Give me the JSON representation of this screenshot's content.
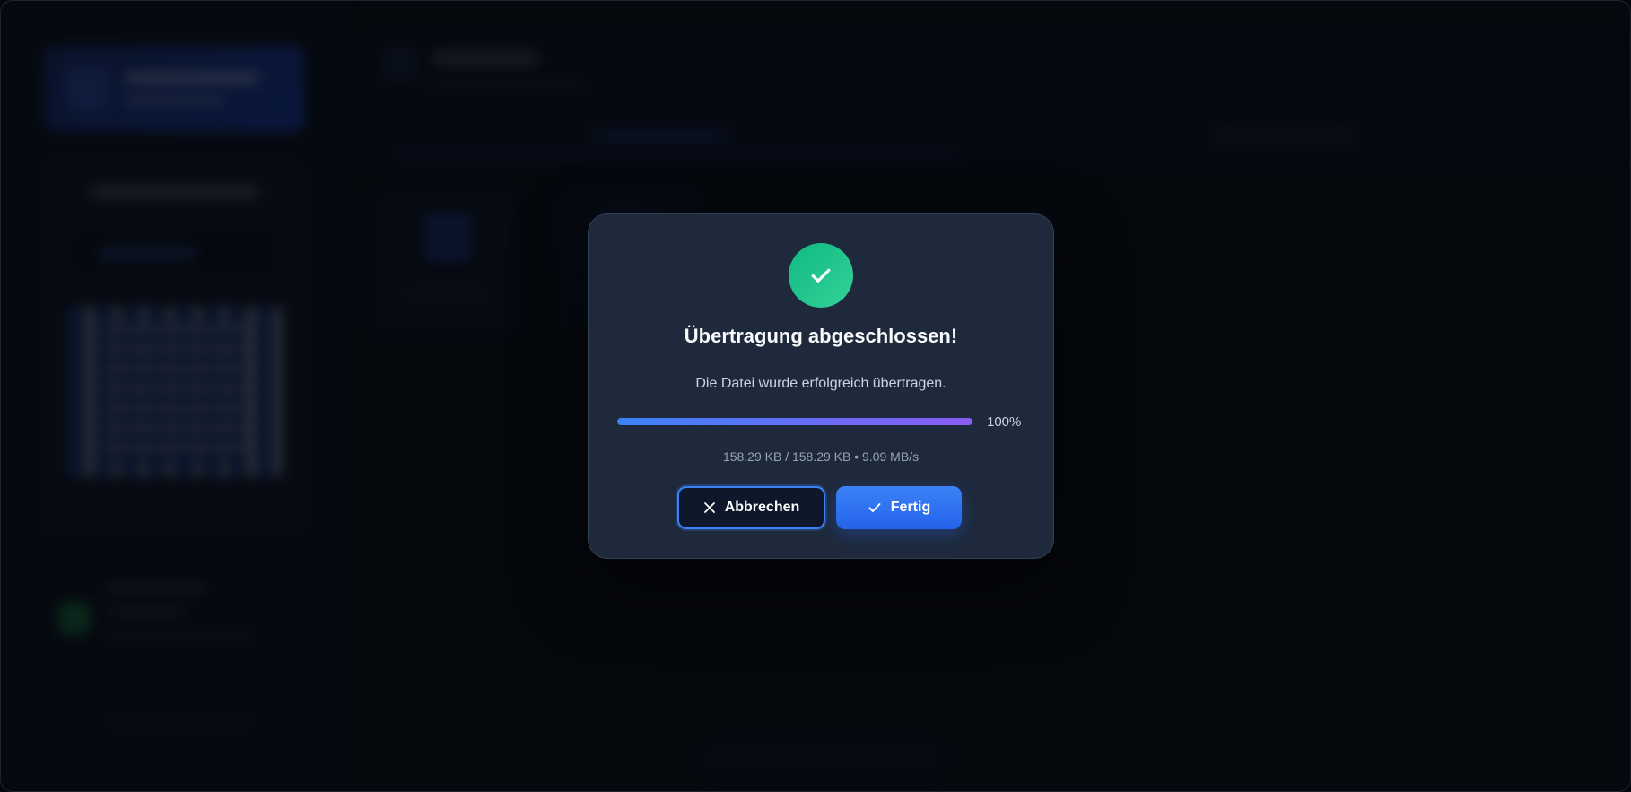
{
  "dialog": {
    "title": "Übertragung abgeschlossen!",
    "message": "Die Datei wurde erfolgreich übertragen.",
    "progress": {
      "percent_value": 100,
      "percent_label": "100%"
    },
    "stats": "158.29 KB / 158.29 KB • 9.09 MB/s",
    "buttons": {
      "cancel_label": "Abbrechen",
      "done_label": "Fertig"
    }
  },
  "icons": {
    "status": "checkmark-icon",
    "cancel": "close-icon",
    "done": "checkmark-icon"
  },
  "colors": {
    "success": "#10b981",
    "accent": "#3b82f6",
    "progress_start": "#3b82f6",
    "progress_end": "#8b5cf6",
    "dialog_bg": "#1e293b"
  }
}
